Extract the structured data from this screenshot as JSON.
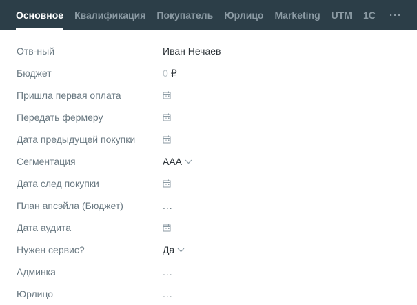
{
  "tabs": [
    {
      "label": "Основное",
      "active": true
    },
    {
      "label": "Квалификация",
      "active": false
    },
    {
      "label": "Покупатель",
      "active": false
    },
    {
      "label": "Юрлицо",
      "active": false
    },
    {
      "label": "Marketing",
      "active": false
    },
    {
      "label": "UTM",
      "active": false
    },
    {
      "label": "1С",
      "active": false
    }
  ],
  "more_label": "···",
  "fields": {
    "responsible": {
      "label": "Отв-ный",
      "value": "Иван Нечаев"
    },
    "budget": {
      "label": "Бюджет",
      "value": "0",
      "currency": "₽"
    },
    "first_payment": {
      "label": "Пришла первая оплата",
      "icon": "calendar-icon"
    },
    "farmer": {
      "label": "Передать фермеру",
      "icon": "calendar-icon"
    },
    "prev_purchase": {
      "label": "Дата предыдущей покупки",
      "icon": "calendar-icon"
    },
    "segmentation": {
      "label": "Сегментация",
      "value": "AAA"
    },
    "next_purchase": {
      "label": "Дата след покупки",
      "icon": "calendar-icon"
    },
    "upsell_plan": {
      "label": "План апсэйла (Бюджет)",
      "value": "..."
    },
    "audit_date": {
      "label": "Дата аудита",
      "icon": "calendar-icon"
    },
    "need_service": {
      "label": "Нужен сервис?",
      "value": "Да"
    },
    "admin": {
      "label": "Админка",
      "value": "..."
    },
    "legal_entity": {
      "label": "Юрлицо",
      "value": "..."
    }
  },
  "colors": {
    "header_bg": "#2c3e48",
    "tab_active": "#ffffff",
    "tab_inactive": "#8b9aa3",
    "label": "#6b7a83",
    "value": "#2c3338"
  }
}
